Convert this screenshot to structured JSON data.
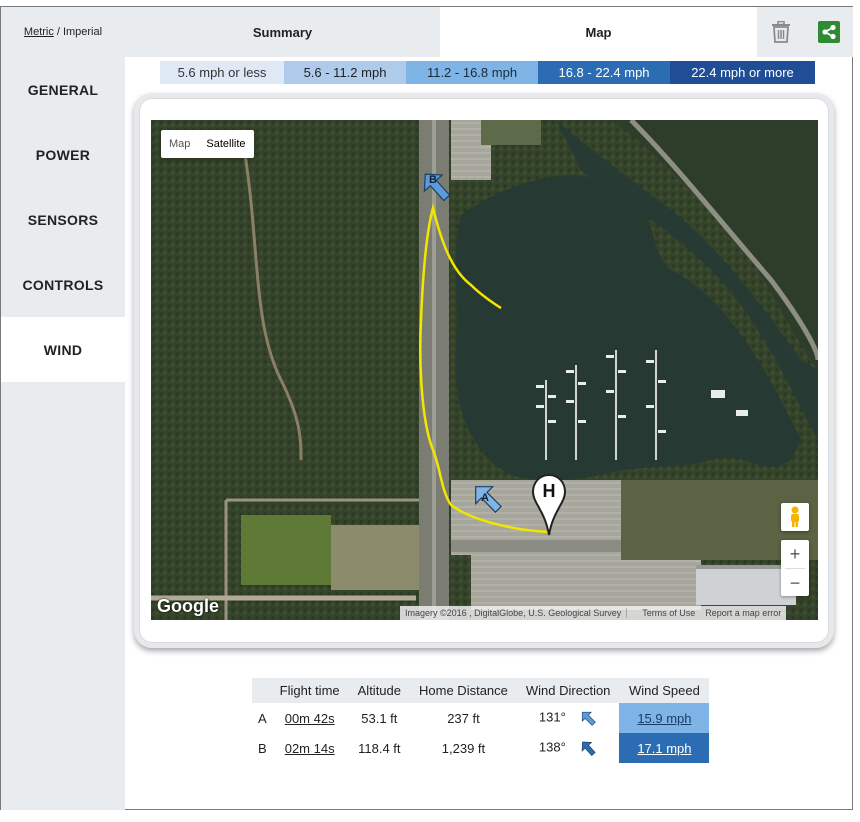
{
  "units": {
    "metric": "Metric",
    "separator": "/",
    "imperial": "Imperial"
  },
  "tabs": {
    "summary": "Summary",
    "map": "Map"
  },
  "toolbar": {
    "delete_icon": "trash-icon",
    "share_icon": "share-icon",
    "share_color": "#2e8b34"
  },
  "sidebar": {
    "items": [
      {
        "label": "GENERAL"
      },
      {
        "label": "POWER"
      },
      {
        "label": "SENSORS"
      },
      {
        "label": "CONTROLS"
      },
      {
        "label": "WIND"
      }
    ],
    "active": "WIND"
  },
  "legend": [
    {
      "label": "5.6 mph or less",
      "color": "#dfe9f5",
      "text_color": "#333333"
    },
    {
      "label": "5.6 - 11.2 mph",
      "color": "#aecbec",
      "text_color": "#222222"
    },
    {
      "label": "11.2 - 16.8 mph",
      "color": "#7fb4e6",
      "text_color": "#1a2a3a"
    },
    {
      "label": "16.8 - 22.4 mph",
      "color": "#2b6cb3",
      "text_color": "#ffffff"
    },
    {
      "label": "22.4 mph or more",
      "color": "#1f4e96",
      "text_color": "#ffffff"
    }
  ],
  "map": {
    "type_buttons": {
      "map": "Map",
      "satellite": "Satellite"
    },
    "logo": "Google",
    "attribution": "Imagery ©2016 , DigitalGlobe, U.S. Geological Survey",
    "terms": "Terms of Use",
    "report": "Report a map error",
    "zoom_in": "+",
    "zoom_out": "−",
    "home_marker": "H",
    "markers": [
      {
        "label": "A"
      },
      {
        "label": "B"
      }
    ],
    "path_color": "#f2e600"
  },
  "table": {
    "headers": [
      "",
      "Flight time",
      "Altitude",
      "Home Distance",
      "Wind Direction",
      "Wind Speed"
    ],
    "rows": [
      {
        "id": "A",
        "flight_time": "00m 42s",
        "altitude": "53.1 ft",
        "home_distance": "237 ft",
        "wind_direction": "131°",
        "wind_speed": "15.9 mph"
      },
      {
        "id": "B",
        "flight_time": "02m 14s",
        "altitude": "118.4 ft",
        "home_distance": "1,239 ft",
        "wind_direction": "138°",
        "wind_speed": "17.1 mph"
      }
    ]
  }
}
